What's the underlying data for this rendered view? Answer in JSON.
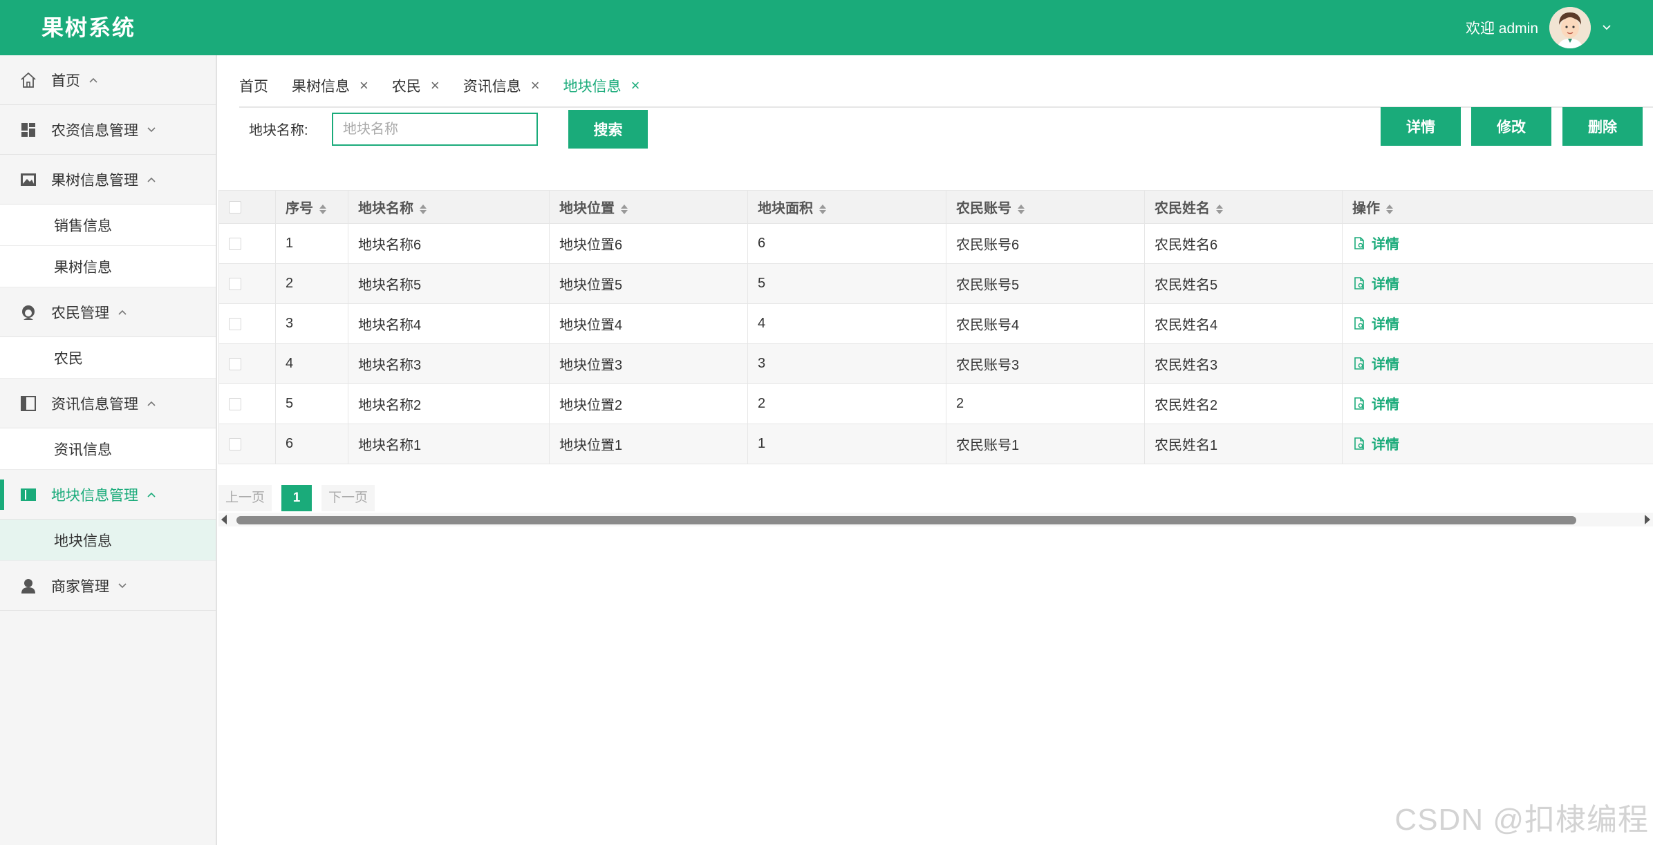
{
  "app": {
    "title": "果树系统"
  },
  "header": {
    "welcome": "欢迎 admin"
  },
  "sidebar": {
    "items": [
      {
        "label": "首页",
        "icon": "home-icon",
        "arrow": "up"
      },
      {
        "label": "农资信息管理",
        "icon": "dashboard-icon",
        "arrow": "down"
      },
      {
        "label": "果树信息管理",
        "icon": "image-icon",
        "arrow": "up",
        "children": [
          "销售信息",
          "果树信息"
        ]
      },
      {
        "label": "农民管理",
        "icon": "farmer-icon",
        "arrow": "up",
        "children": [
          "农民"
        ]
      },
      {
        "label": "资讯信息管理",
        "icon": "panel-icon",
        "arrow": "up",
        "children": [
          "资讯信息"
        ]
      },
      {
        "label": "地块信息管理",
        "icon": "book-icon",
        "arrow": "up",
        "active": true,
        "children": [
          "地块信息"
        ]
      },
      {
        "label": "商家管理",
        "icon": "user-icon",
        "arrow": "down"
      }
    ]
  },
  "tabs": [
    {
      "label": "首页",
      "closable": false
    },
    {
      "label": "果树信息",
      "closable": true
    },
    {
      "label": "农民",
      "closable": true
    },
    {
      "label": "资讯信息",
      "closable": true
    },
    {
      "label": "地块信息",
      "closable": true,
      "active": true
    }
  ],
  "search": {
    "label": "地块名称:",
    "placeholder": "地块名称",
    "value": "",
    "button": "搜索"
  },
  "actions": {
    "detail": "详情",
    "edit": "修改",
    "delete": "删除"
  },
  "table": {
    "headers": [
      "序号",
      "地块名称",
      "地块位置",
      "地块面积",
      "农民账号",
      "农民姓名",
      "操作"
    ],
    "rows": [
      [
        "1",
        "地块名称6",
        "地块位置6",
        "6",
        "农民账号6",
        "农民姓名6",
        "详情"
      ],
      [
        "2",
        "地块名称5",
        "地块位置5",
        "5",
        "农民账号5",
        "农民姓名5",
        "详情"
      ],
      [
        "3",
        "地块名称4",
        "地块位置4",
        "4",
        "农民账号4",
        "农民姓名4",
        "详情"
      ],
      [
        "4",
        "地块名称3",
        "地块位置3",
        "3",
        "农民账号3",
        "农民姓名3",
        "详情"
      ],
      [
        "5",
        "地块名称2",
        "地块位置2",
        "2",
        "2",
        "农民姓名2",
        "详情"
      ],
      [
        "6",
        "地块名称1",
        "地块位置1",
        "1",
        "农民账号1",
        "农民姓名1",
        "详情"
      ]
    ]
  },
  "pagination": {
    "prev": "上一页",
    "current": "1",
    "next": "下一页"
  },
  "watermark": "CSDN @扣棣编程",
  "colors": {
    "accent": "#1aab7a",
    "header_bg": "#1aab7a"
  }
}
